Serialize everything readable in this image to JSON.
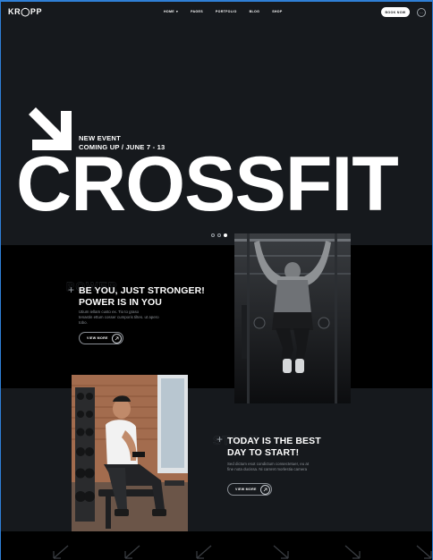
{
  "header": {
    "logo": "KR◯PP",
    "nav": [
      {
        "label": "HOME",
        "has_caret": true
      },
      {
        "label": "PAGES"
      },
      {
        "label": "PORTFOLIO"
      },
      {
        "label": "BLOG"
      },
      {
        "label": "SHOP"
      }
    ],
    "book_button": "BOOK NOW"
  },
  "hero": {
    "event_line1": "NEW EVENT",
    "event_line2": "COMING UP / JUNE 7 - 13",
    "headline": "CROSSFIT",
    "slider_dots": 3,
    "active_dot": 3
  },
  "section1": {
    "title_line1": "BE YOU, JUST STRONGER!",
    "title_line2": "POWER IS IN YOU",
    "text_line1": "Utium iellam custo ex. Tio to graso",
    "text_line2": "tenastin ettum cosser cumporis tiltes. ut apero",
    "text_line3": "tobo.",
    "button": "VIEW MORE"
  },
  "section2": {
    "title_line1": "TODAY IS THE BEST",
    "title_line2": "DAY TO START!",
    "text_line1": "Sed dictum esot condictum consectetuer, eu at",
    "text_line2": "fine nota ducissa. Ni camret morlestia camera",
    "button": "VIEW MORE"
  },
  "colors": {
    "background": "#16191d",
    "band_dark": "#000000",
    "accent_frame": "#2f7fd6",
    "text": "#ffffff",
    "muted": "#8b9096"
  }
}
